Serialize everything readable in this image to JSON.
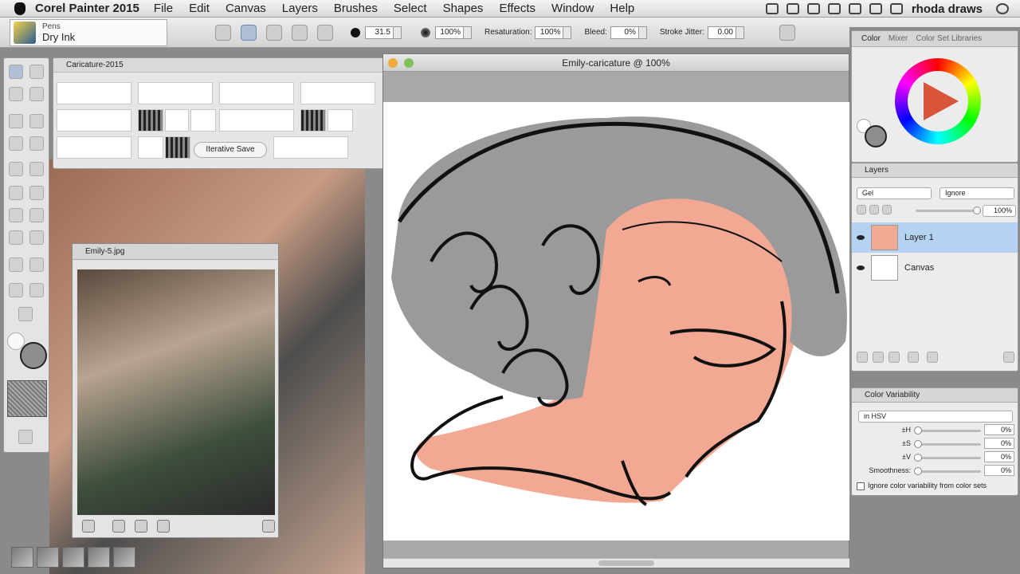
{
  "menubar": {
    "app": "Corel Painter 2015",
    "items": [
      "File",
      "Edit",
      "Canvas",
      "Layers",
      "Brushes",
      "Select",
      "Shapes",
      "Effects",
      "Window",
      "Help"
    ],
    "user": "rhoda draws"
  },
  "property_bar": {
    "brush_category": "Pens",
    "brush_variant": "Dry Ink",
    "size": "31.5",
    "opacity": "100%",
    "resaturation_label": "Resaturation:",
    "resaturation": "100%",
    "bleed_label": "Bleed:",
    "bleed": "0%",
    "jitter_label": "Stroke Jitter:",
    "jitter": "0.00"
  },
  "brush_library": {
    "title": "Caricature-2015",
    "iterative_save": "Iterative Save"
  },
  "reference_window": {
    "title": "Emily-5.jpg"
  },
  "canvas_window": {
    "title": "Emily-caricature @ 100%"
  },
  "color_panel": {
    "tabs": [
      "Color",
      "Mixer",
      "Color Set Libraries"
    ],
    "main_color": "#8e8e8e",
    "hue_indicator": "#d8543a"
  },
  "layers_panel": {
    "title": "Layers",
    "composite_method": "Gel",
    "preserve": "Ignore",
    "opacity": "100%",
    "layers": [
      "Layer 1",
      "Canvas"
    ]
  },
  "color_variability": {
    "title": "Color Variability",
    "mode": "in HSV",
    "h_label": "±H",
    "h": "0%",
    "s_label": "±S",
    "s": "0%",
    "v_label": "±V",
    "v": "0%",
    "smooth_label": "Smoothness:",
    "smooth": "0%",
    "ignore_label": "Ignore color variability from color sets"
  },
  "colors": {
    "skin": "#f2a892",
    "hair": "#9a9a9a",
    "ink": "#111111"
  }
}
